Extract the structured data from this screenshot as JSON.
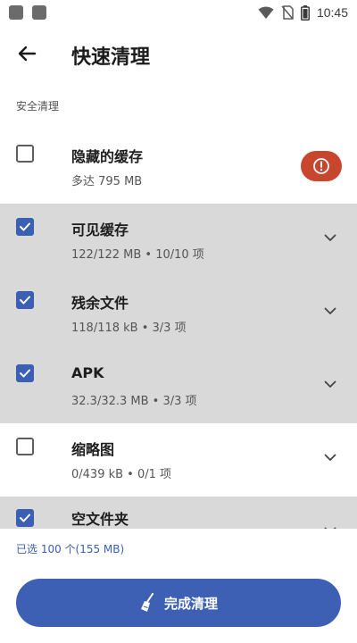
{
  "status_bar": {
    "time": "10:45",
    "icons": [
      "wifi-icon",
      "no-sim-icon",
      "battery-icon"
    ]
  },
  "app_bar": {
    "back_icon": "arrow-left-icon",
    "title": "快速清理"
  },
  "section": {
    "label": "安全清理"
  },
  "items": [
    {
      "title": "隐藏的缓存",
      "subtitle": "多达 795 MB",
      "checked": false,
      "trailing": "alert-icon"
    },
    {
      "title": "可见缓存",
      "subtitle": "122/122 MB • 10/10 项",
      "checked": true,
      "trailing": "chevron-down-icon"
    },
    {
      "title": "残余文件",
      "subtitle": "118/118 kB • 3/3 项",
      "checked": true,
      "trailing": "chevron-down-icon"
    },
    {
      "title": "APK",
      "subtitle": "32.3/32.3 MB • 3/3 项",
      "checked": true,
      "trailing": "chevron-down-icon"
    },
    {
      "title": "缩略图",
      "subtitle": "0/439 kB • 0/1 项",
      "checked": false,
      "trailing": "chevron-down-icon"
    },
    {
      "title": "空文件夹",
      "subtitle": "",
      "checked": true,
      "trailing": "chevron-down-icon"
    }
  ],
  "footer": {
    "selected_summary": "已选 100 个(155 MB)",
    "primary_button": {
      "label": "完成清理",
      "icon": "broom-icon"
    }
  },
  "colors": {
    "accent": "#3d60b4",
    "checkbox_checked": "#3a5fb3",
    "selected_row_bg": "#d9d9d9",
    "warning": "#c8452e"
  }
}
